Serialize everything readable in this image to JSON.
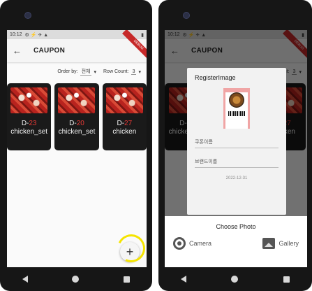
{
  "status": {
    "time": "10:12",
    "icons": "⚙ ⚡ ✈ ▲"
  },
  "appbar": {
    "title": "CAUPON",
    "back": "←",
    "ribbon": "DEBUG"
  },
  "filters": {
    "order_label": "Order by:",
    "order_value": "전체",
    "row_label": "Row Count:",
    "row_value": "3"
  },
  "coupons": [
    {
      "dday_prefix": "D-",
      "dday": "23",
      "name": "chicken_set"
    },
    {
      "dday_prefix": "D-",
      "dday": "20",
      "name": "chicken_set"
    },
    {
      "dday_prefix": "D-",
      "dday": "27",
      "name": "chicken"
    }
  ],
  "fab": {
    "label": "+"
  },
  "dialog": {
    "title": "RegisterImage",
    "field1": "쿠폰이름",
    "field2": "브랜드이름",
    "date": "2022-12-31"
  },
  "sheet": {
    "title": "Choose Photo",
    "camera": "Camera",
    "gallery": "Gallery"
  },
  "colors": {
    "accent": "#e53935",
    "card": "#1a1a1a",
    "highlight": "#f5e400"
  }
}
